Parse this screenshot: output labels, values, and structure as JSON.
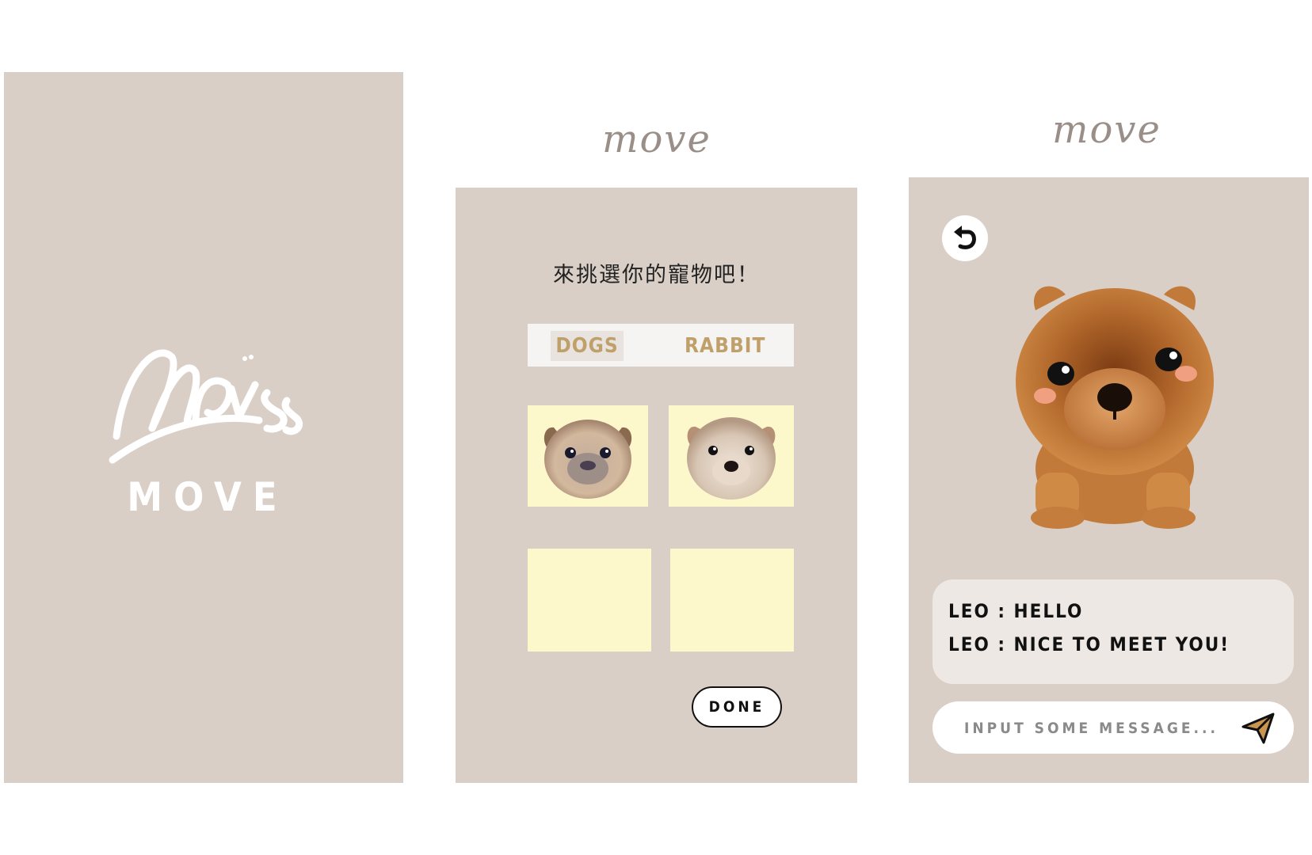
{
  "splash": {
    "logo_word": "MOVE"
  },
  "select_screen": {
    "header_logo": "move",
    "prompt": "來挑選你的寵物吧！",
    "tabs": [
      {
        "label": "DOGS"
      },
      {
        "label": "RABBIT"
      }
    ],
    "done_label": "DONE"
  },
  "chat_screen": {
    "header_logo": "move",
    "messages": [
      "LEO : HELLO",
      "LEO : NICE TO MEET YOU!"
    ],
    "input": {
      "placeholder": "INPUT SOME MESSAGE...",
      "value": ""
    }
  },
  "colors": {
    "screen_bg": "#d9cfc7",
    "card_bg": "#fdf8cc",
    "tab_text": "#c0a06a",
    "logo_gray": "#9a8f88"
  },
  "icons": {
    "back": "undo-arrow-icon",
    "send": "send-arrow-icon"
  }
}
